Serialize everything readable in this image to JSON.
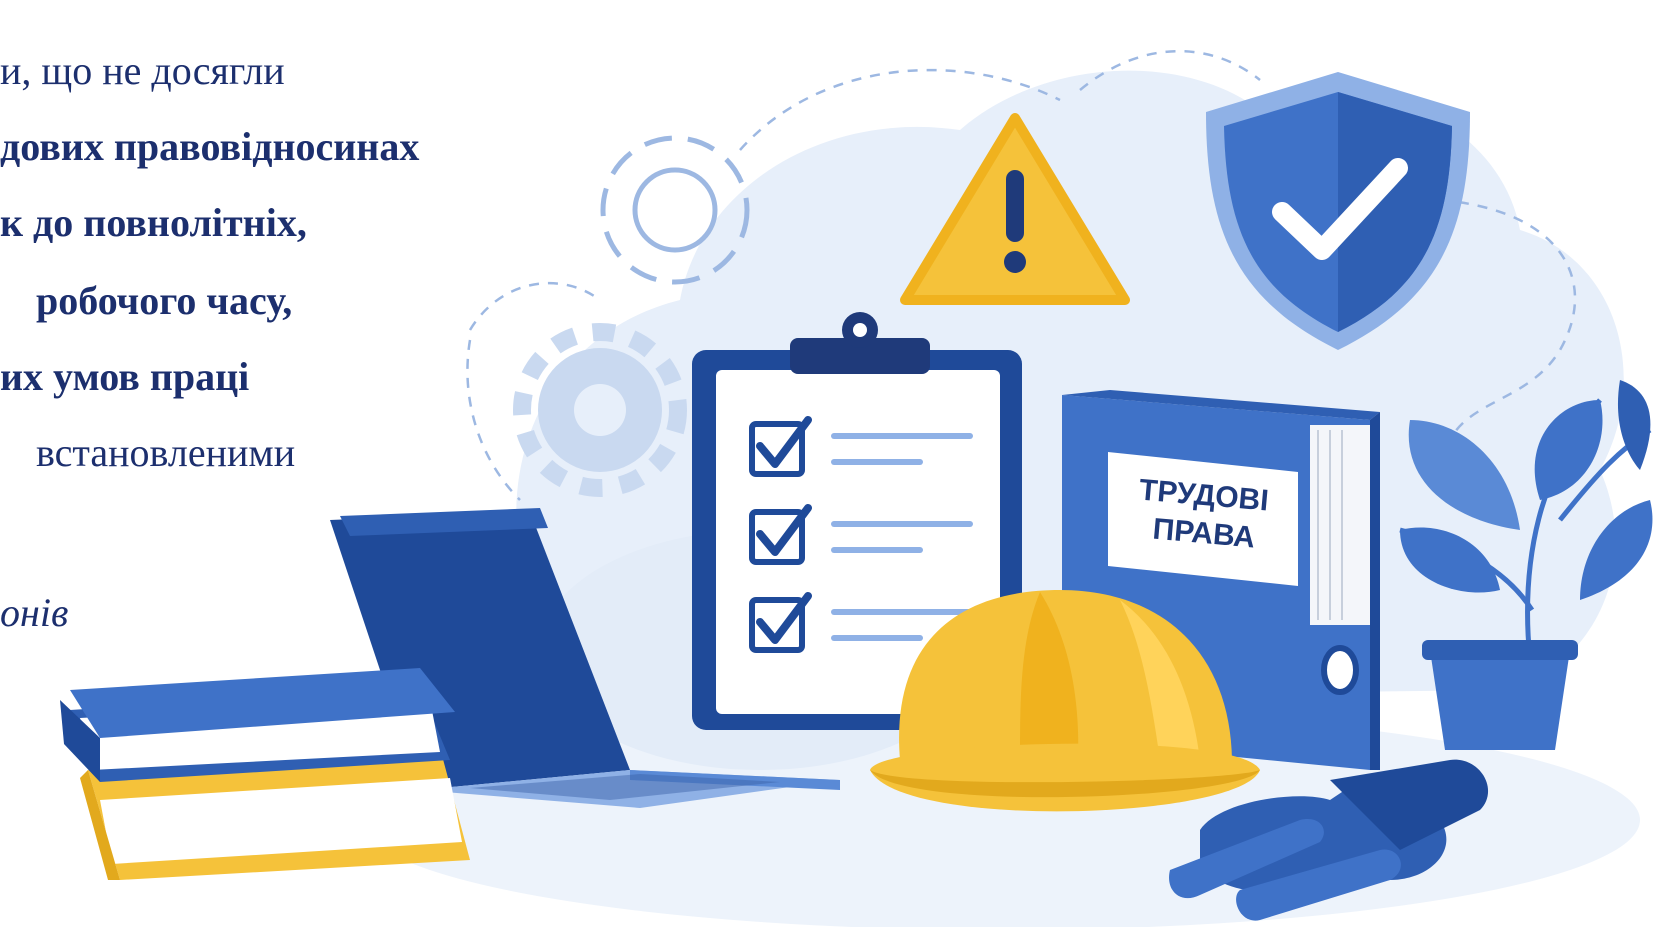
{
  "text_lines": [
    "и, що не досягли",
    "дових правовідносинах",
    "к до повнолітніх,",
    "робочого часу,",
    "их умов праці",
    "встановленими",
    "онів"
  ],
  "binder_label_line1": "ТРУДОВІ",
  "binder_label_line2": "ПРАВА",
  "colors": {
    "navy_text": "#1c2f6e",
    "blue": "#3f72c8",
    "dark_blue": "#1f4a99",
    "yellow": "#f5c23a",
    "light_blue_bg": "#e7effa"
  },
  "illustration_items": [
    "gear-icon",
    "warning-icon",
    "shield-check-icon",
    "clipboard-checklist",
    "binder",
    "hard-hat",
    "laptop",
    "books",
    "plant",
    "gloves"
  ]
}
